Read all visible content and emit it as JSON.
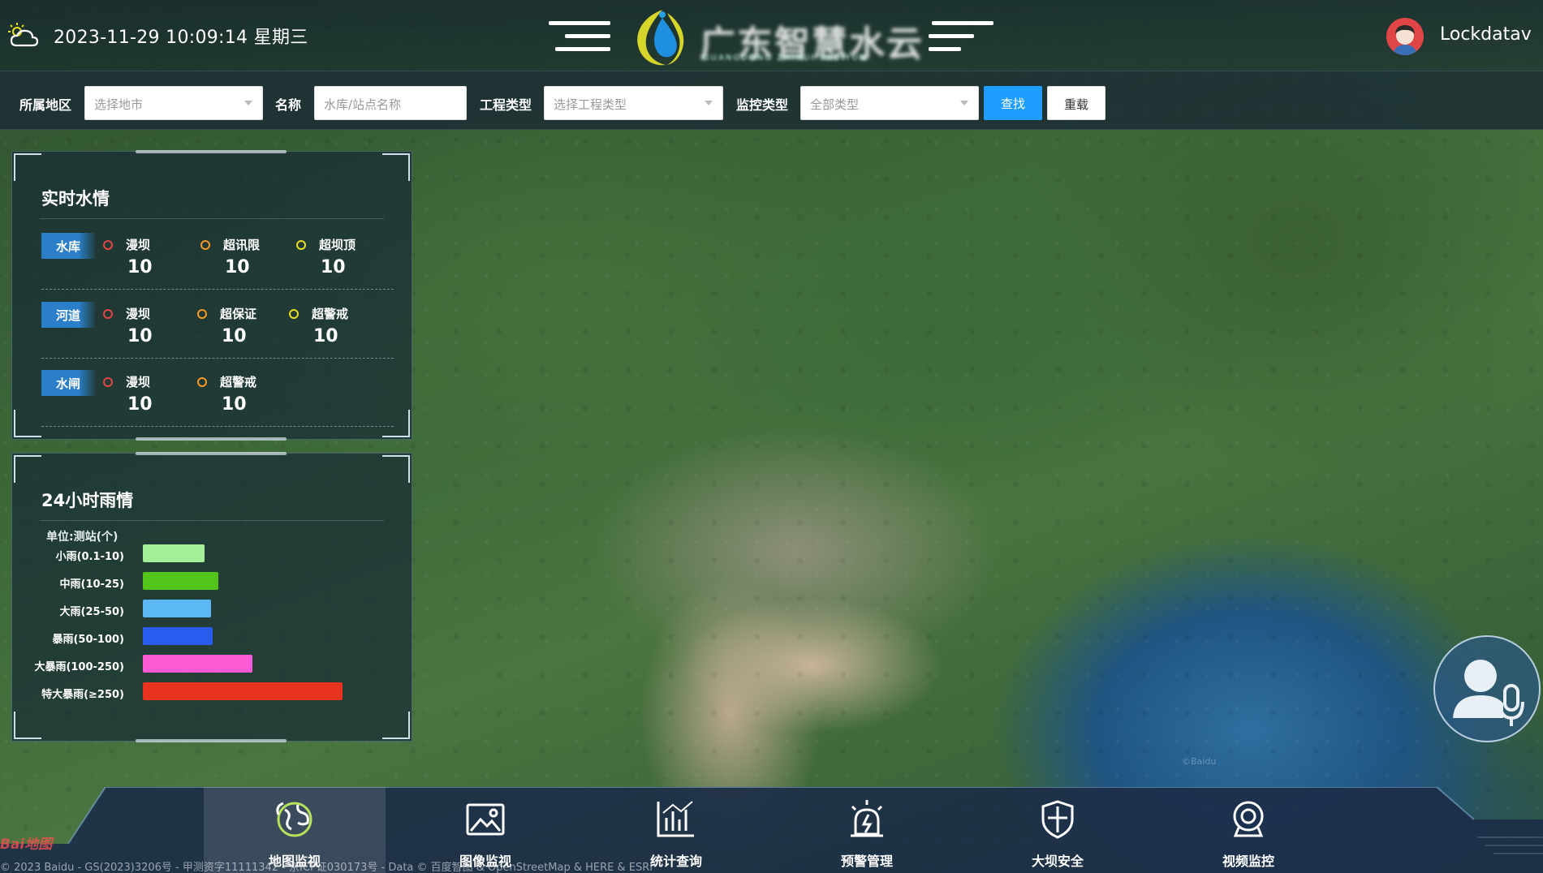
{
  "header": {
    "datetime": "2023-11-29 10:09:14 星期三",
    "logo_title": "广东智慧水云",
    "logo_subtitle": "GUANGDONG ZHIHUI SHUIYUN",
    "username": "Lockdatav"
  },
  "filters": {
    "region_label": "所属地区",
    "region_placeholder": "选择地市",
    "name_label": "名称",
    "name_placeholder": "水库/站点名称",
    "project_label": "工程类型",
    "project_placeholder": "选择工程类型",
    "monitor_label": "监控类型",
    "monitor_placeholder": "全部类型",
    "search_button": "查找",
    "reset_button": "重载"
  },
  "water_panel": {
    "title": "实时水情",
    "rows": [
      {
        "tag": "水库",
        "items": [
          {
            "name": "漫坝",
            "value": "10",
            "color": "#e64545"
          },
          {
            "name": "超讯限",
            "value": "10",
            "color": "#f59a23"
          },
          {
            "name": "超坝顶",
            "value": "10",
            "color": "#e8e020"
          }
        ]
      },
      {
        "tag": "河道",
        "items": [
          {
            "name": "漫坝",
            "value": "10",
            "color": "#e64545"
          },
          {
            "name": "超保证",
            "value": "10",
            "color": "#f59a23"
          },
          {
            "name": "超警戒",
            "value": "10",
            "color": "#e8e020"
          }
        ]
      },
      {
        "tag": "水闸",
        "items": [
          {
            "name": "漫坝",
            "value": "10",
            "color": "#e64545"
          },
          {
            "name": "超警戒",
            "value": "10",
            "color": "#f59a23"
          }
        ]
      }
    ]
  },
  "rain_panel": {
    "title": "24小时雨情",
    "unit": "单位:测站(个)",
    "chart_data": {
      "type": "bar",
      "orientation": "horizontal",
      "categories": [
        "小雨(0.1-10)",
        "中雨(10-25)",
        "大雨(25-50)",
        "暴雨(50-100)",
        "大暴雨(100-250)",
        "特大暴雨(≥250)"
      ],
      "values": [
        31,
        38,
        34,
        35,
        55,
        100
      ],
      "colors": [
        "#a6ef9a",
        "#52c41a",
        "#5cb8f5",
        "#2a5cf0",
        "#ff5ad6",
        "#e8331f"
      ],
      "xlim": [
        0,
        100
      ]
    }
  },
  "bottom_nav": {
    "items": [
      {
        "label": "地图监视",
        "icon": "globe-icon",
        "active": true
      },
      {
        "label": "图像监视",
        "icon": "image-icon",
        "active": false
      },
      {
        "label": "统计查询",
        "icon": "chart-icon",
        "active": false
      },
      {
        "label": "预警管理",
        "icon": "alarm-icon",
        "active": false
      },
      {
        "label": "大坝安全",
        "icon": "shield-icon",
        "active": false
      },
      {
        "label": "视频监控",
        "icon": "camera-icon",
        "active": false
      }
    ]
  },
  "map": {
    "attribution": "© 2023 Baidu - GS(2023)3206号 - 甲测资字11111342 - 京ICP证030173号 - Data © 百度智图 & OpenStreetMap & HERE & ESRI",
    "logo": "Bai地图",
    "watermark": "©Baidu"
  }
}
